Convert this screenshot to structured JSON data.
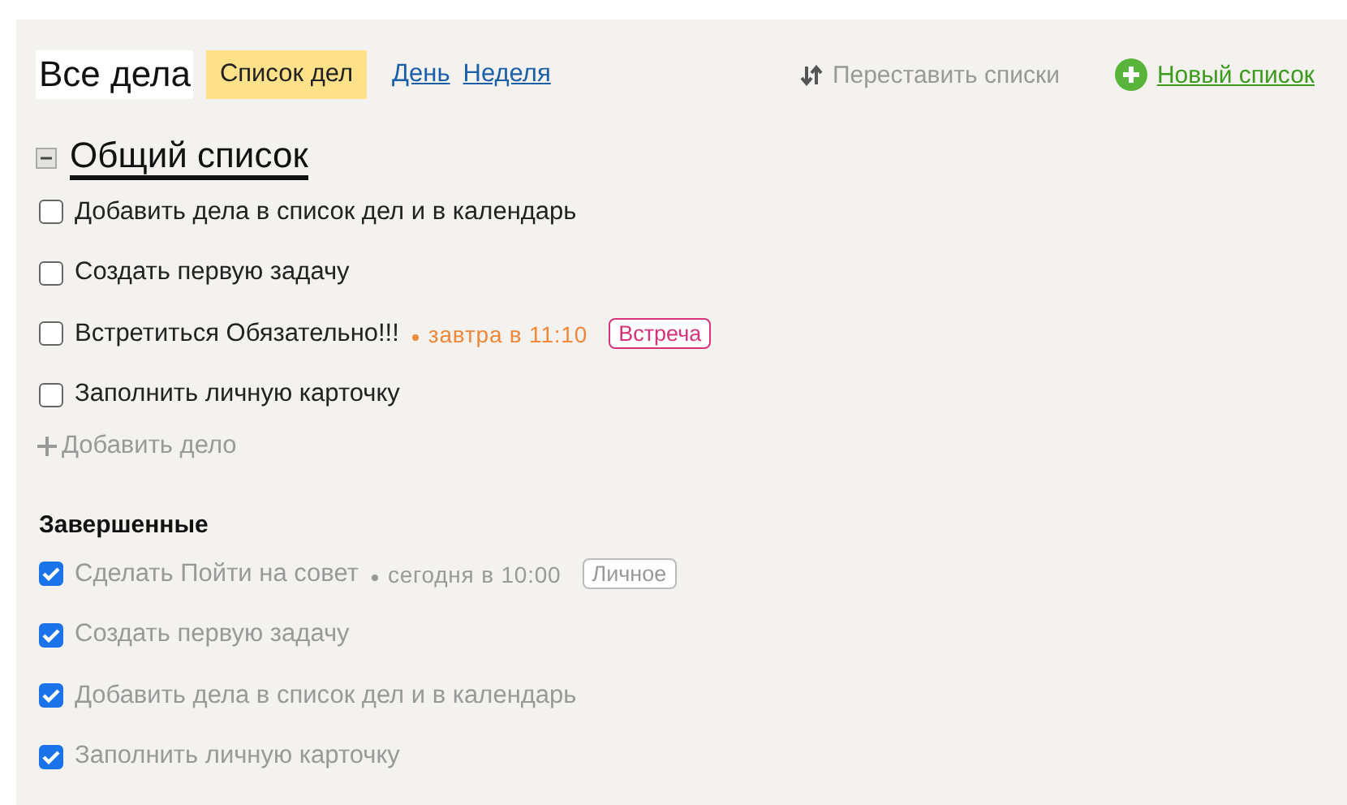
{
  "header": {
    "title": "Все дела",
    "tabs": [
      {
        "label": "Список дел",
        "selected": true
      },
      {
        "label": "День",
        "selected": false
      },
      {
        "label": "Неделя",
        "selected": false
      }
    ],
    "reorder": "Переставить списки",
    "new_list": "Новый список"
  },
  "list": {
    "title": "Общий список",
    "expanded": true,
    "tasks": [
      {
        "text": "Добавить дела в список дел и в календарь",
        "checked": false
      },
      {
        "text": "Создать первую задачу",
        "checked": false
      },
      {
        "text": "Встретиться Обязательно!!!",
        "checked": false,
        "due": {
          "text": "завтра в 11:10",
          "color": "#f0883a"
        },
        "tag": {
          "text": "Встреча",
          "color": "#d6337a"
        }
      },
      {
        "text": "Заполнить личную карточку",
        "checked": false
      }
    ],
    "add": "Добавить дело"
  },
  "completed": {
    "title": "Завершенные",
    "tasks": [
      {
        "text": "Сделать Пойти на совет",
        "checked": true,
        "due": {
          "text": "сегодня в 10:00",
          "color": "#999999"
        },
        "tag": {
          "text": "Личное",
          "color": "#bbbbbb"
        }
      },
      {
        "text": "Создать первую задачу",
        "checked": true
      },
      {
        "text": "Добавить дела в список дел и в календарь",
        "checked": true
      },
      {
        "text": "Заполнить личную карточку",
        "checked": true
      }
    ]
  }
}
